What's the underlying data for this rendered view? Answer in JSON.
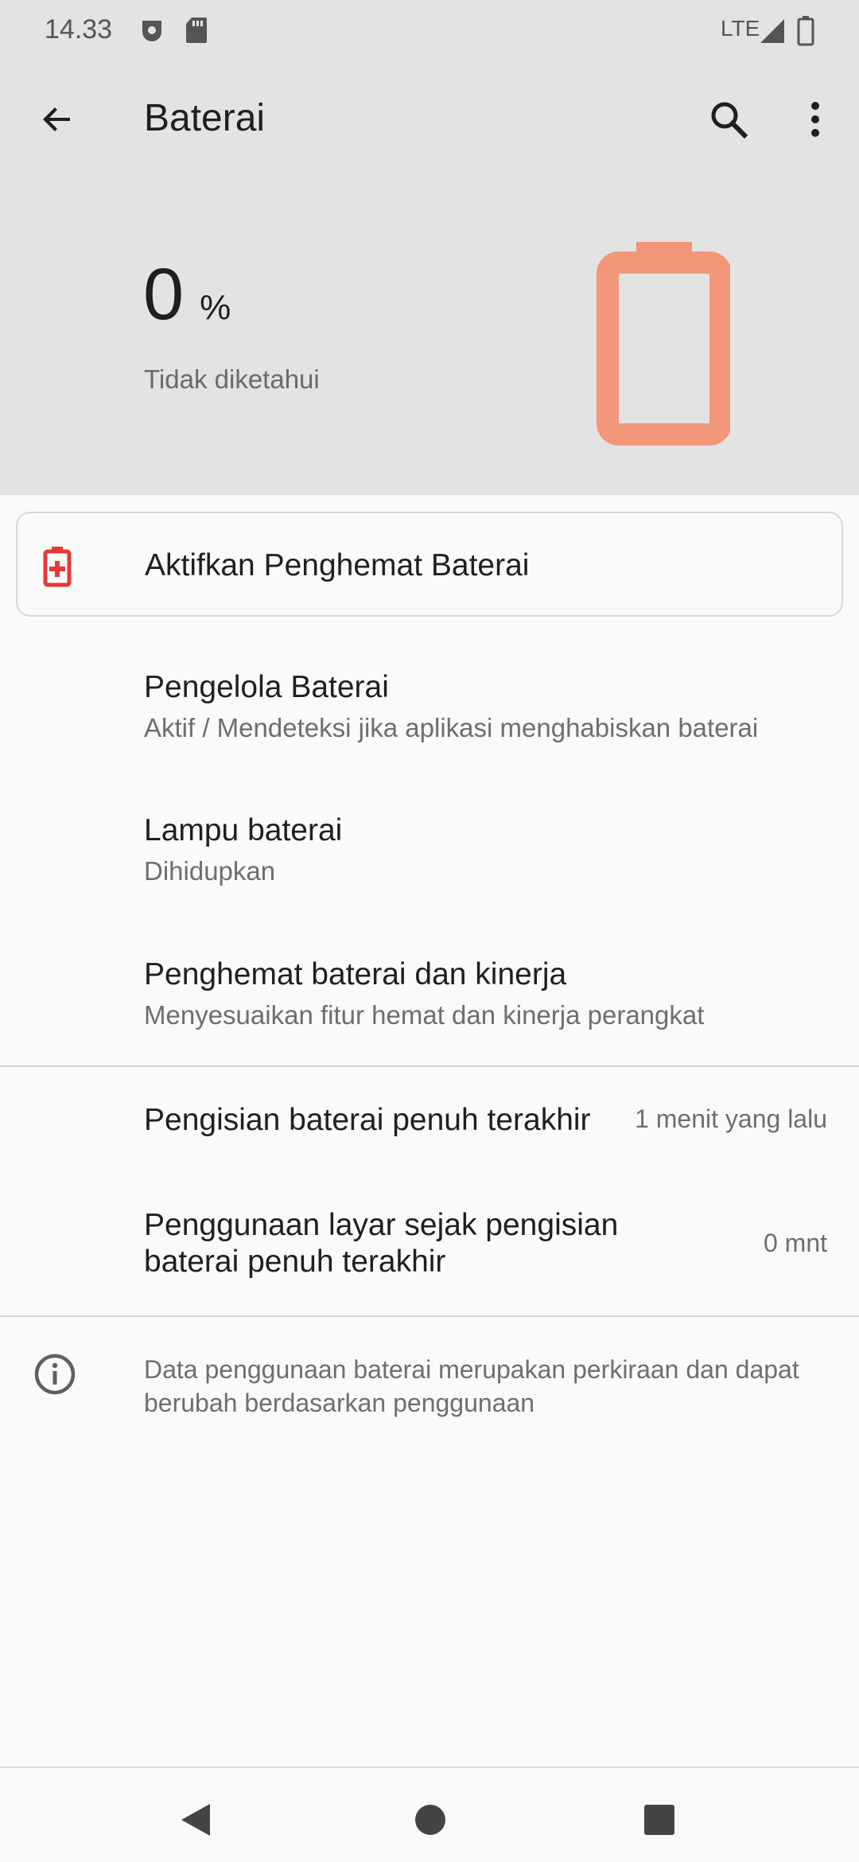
{
  "status_bar": {
    "time": "14.33",
    "network": "LTE",
    "icons": [
      "notification-icon",
      "sd-card-icon",
      "signal-icon",
      "battery-icon"
    ]
  },
  "app_bar": {
    "title": "Baterai",
    "icons": [
      "back-arrow-icon",
      "search-icon",
      "more-vert-icon"
    ]
  },
  "battery": {
    "level": "0",
    "unit": "%",
    "status": "Tidak diketahui",
    "color": "#f2977a"
  },
  "saver_card": {
    "label": "Aktifkan Penghemat Baterai",
    "icon": "battery-saver-icon",
    "icon_color": "#e53935"
  },
  "preferences": [
    {
      "title": "Pengelola Baterai",
      "summary": "Aktif / Mendeteksi jika aplikasi menghabiskan baterai"
    },
    {
      "title": "Lampu baterai",
      "summary": "Dihidupkan"
    },
    {
      "title": "Penghemat baterai dan kinerja",
      "summary": "Menyesuaikan fitur hemat dan kinerja perangkat"
    }
  ],
  "usage": [
    {
      "label": "Pengisian baterai penuh terakhir",
      "value": "1 menit yang lalu"
    },
    {
      "label_line1": "Penggunaan layar sejak pengisian",
      "label_line2": "baterai penuh terakhir",
      "value": "0 mnt"
    }
  ],
  "footer": {
    "icon": "info-icon",
    "text": "Data penggunaan baterai merupakan perkiraan dan dapat berubah berdasarkan penggunaan"
  },
  "nav_bar": {
    "icons": [
      "back-triangle-icon",
      "home-circle-icon",
      "recents-square-icon"
    ]
  }
}
